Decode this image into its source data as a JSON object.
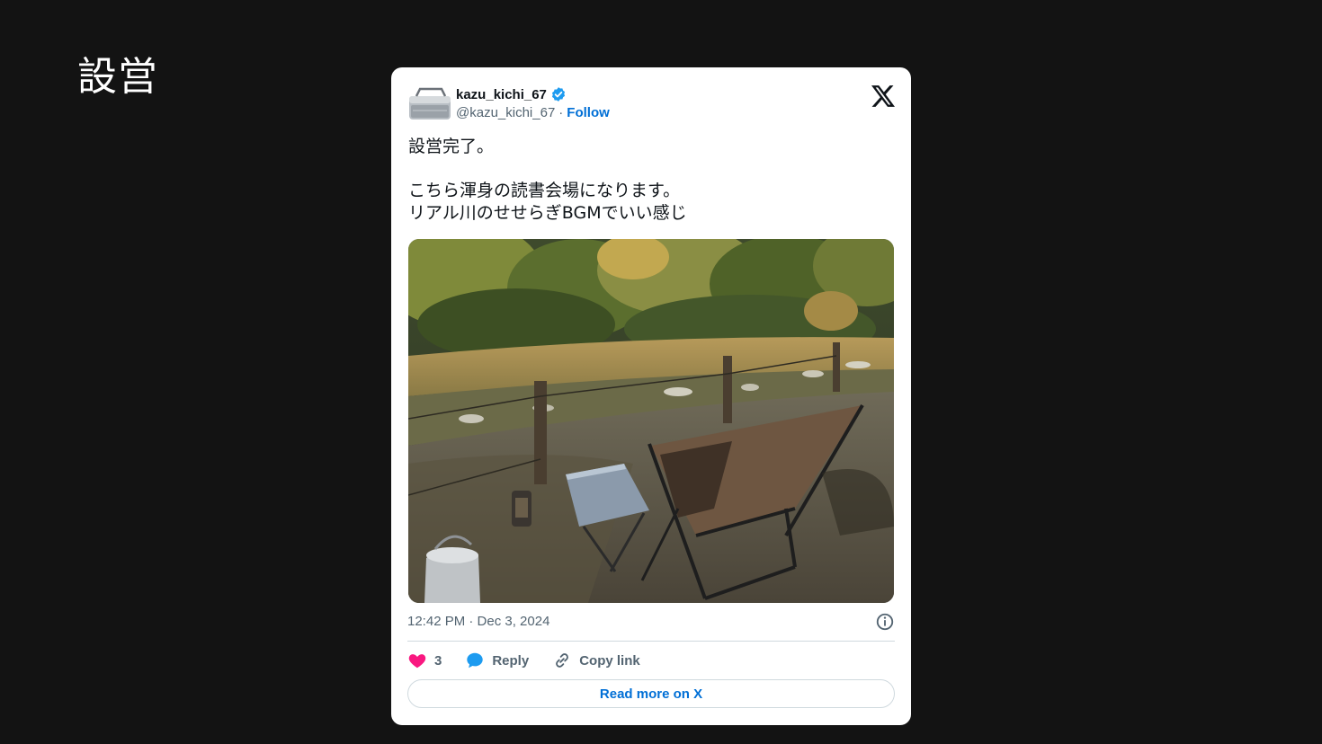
{
  "slide": {
    "title": "設営"
  },
  "tweet": {
    "display_name": "kazu_kichi_67",
    "handle": "@kazu_kichi_67",
    "separator": "·",
    "follow_label": "Follow",
    "text_lines": [
      "設営完了。",
      "",
      "こちら渾身の読書会場になります。",
      "リアル川のせせらぎBGMでいい感じ"
    ],
    "timestamp": "12:42 PM · Dec 3, 2024",
    "like_count": "3",
    "reply_label": "Reply",
    "copy_link_label": "Copy link",
    "read_more_label": "Read more on X"
  },
  "colors": {
    "background": "#131313",
    "link": "#006fd6",
    "like": "#f91880",
    "reply": "#1d9bf0",
    "verified": "#1d9bf0",
    "muted_text": "#536471"
  },
  "icons": {
    "brand": "x-logo-icon",
    "verified": "verified-badge-icon",
    "info": "info-icon",
    "like": "heart-icon",
    "reply": "speech-bubble-icon",
    "copy": "link-icon"
  }
}
